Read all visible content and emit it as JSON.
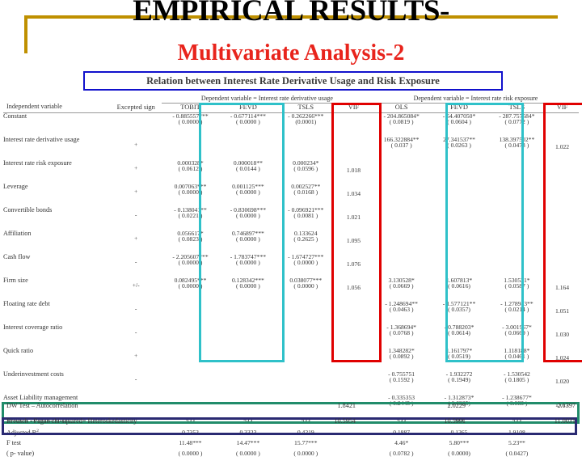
{
  "slide": {
    "title_line1": "EMPIRICAL RESULTS-",
    "title_line2": "Multivariate Analysis-2",
    "caption": "Relation between Interest Rate Derivative Usage and Risk Exposure",
    "accent_gold": "#bf9000",
    "title_red": "#e8241c",
    "caption_border": "#1111cc",
    "highlight_cyan": "#2fc1c9",
    "highlight_red": "#e00000",
    "highlight_green": "#218c6a",
    "highlight_navy": "#2a2a72"
  },
  "table": {
    "group_left": "Dependent variable = Interest rate derivative usage",
    "group_right": "Dependent variable = Interest rate risk exposure",
    "head_var": "Independent variable",
    "head_sign": "Excepted sign",
    "cols": [
      "TOBIT",
      "FEVD",
      "TSLS",
      "VIF",
      "OLS",
      "FEVD",
      "TSLS",
      "VIF"
    ],
    "rows": [
      {
        "name": "Constant",
        "sign": "",
        "tobit_c": "- 0.885557***",
        "tobit_p": "( 0.0000 )",
        "fevd_c": "- 0.677114***",
        "fevd_p": "( 0.0000 )",
        "tsls_c": "- 0.262266***",
        "tsls_p": "(0.0001)",
        "vif": "",
        "ols_c": "- 204.865084*",
        "ols_p": "( 0.0819 )",
        "fevd2_c": "- 54.407050*",
        "fevd2_p": "( 0.0604 )",
        "tsls2_c": "- 287.757584*",
        "tsls2_p": "( 0.0772 )",
        "vif2": ""
      },
      {
        "name": "Interest rate derivative usage",
        "sign": "+",
        "tobit_c": "",
        "tobit_p": "",
        "fevd_c": "",
        "fevd_p": "",
        "tsls_c": "",
        "tsls_p": "",
        "vif": "",
        "ols_c": "166.322884**",
        "ols_p": "( 0.037 )",
        "fevd2_c": "27.341537**",
        "fevd2_p": "( 0.0263 )",
        "tsls2_c": "138.397502**",
        "tsls2_p": "( 0.0473 )",
        "vif2": "1.022"
      },
      {
        "name": "Interest rate risk exposure",
        "sign": "+",
        "tobit_c": "0.000328*",
        "tobit_p": "( 0.0612 )",
        "fevd_c": "0.000018**",
        "fevd_p": "( 0.0144 )",
        "tsls_c": "0.000234*",
        "tsls_p": "( 0.0596 )",
        "vif": "1.018",
        "ols_c": "",
        "ols_p": "",
        "fevd2_c": "",
        "fevd2_p": "",
        "tsls2_c": "",
        "tsls2_p": "",
        "vif2": ""
      },
      {
        "name": "Leverage",
        "sign": "+",
        "tobit_c": "0.007063***",
        "tobit_p": "( 0.0000 )",
        "fevd_c": "0.001125***",
        "fevd_p": "( 0.0000 )",
        "tsls_c": "0.002527**",
        "tsls_p": "( 0.0168 )",
        "vif": "1.034",
        "ols_c": "",
        "ols_p": "",
        "fevd2_c": "",
        "fevd2_p": "",
        "tsls2_c": "",
        "tsls2_p": "",
        "vif2": ""
      },
      {
        "name": "Convertible bonds",
        "sign": "-",
        "tobit_c": "- 0.138041**",
        "tobit_p": "( 0.0221 )",
        "fevd_c": "- 0.830698***",
        "fevd_p": "( 0.0000 )",
        "tsls_c": "- 0.096921***",
        "tsls_p": "( 0.0081 )",
        "vif": "1.021",
        "ols_c": "",
        "ols_p": "",
        "fevd2_c": "",
        "fevd2_p": "",
        "tsls2_c": "",
        "tsls2_p": "",
        "vif2": ""
      },
      {
        "name": "Affiliation",
        "sign": "+",
        "tobit_c": "0.056617*",
        "tobit_p": "( 0.0823 )",
        "fevd_c": "0.746897***",
        "fevd_p": "( 0.0000 )",
        "tsls_c": "0.133624",
        "tsls_p": "( 0.2625 )",
        "vif": "1.095",
        "ols_c": "",
        "ols_p": "",
        "fevd2_c": "",
        "fevd2_p": "",
        "tsls2_c": "",
        "tsls2_p": "",
        "vif2": ""
      },
      {
        "name": "Cash flow",
        "sign": "-",
        "tobit_c": "- 2.205607***",
        "tobit_p": "( 0.0000 )",
        "fevd_c": "- 1.783747***",
        "fevd_p": "( 0.0000 )",
        "tsls_c": "- 1.674727***",
        "tsls_p": "( 0.0000 )",
        "vif": "1.076",
        "ols_c": "",
        "ols_p": "",
        "fevd2_c": "",
        "fevd2_p": "",
        "tsls2_c": "",
        "tsls2_p": "",
        "vif2": ""
      },
      {
        "name": "Firm size",
        "sign": "+/-",
        "tobit_c": "0.082495***",
        "tobit_p": "( 0.0000 )",
        "fevd_c": "0.128342***",
        "fevd_p": "( 0.0000 )",
        "tsls_c": "0.038077***",
        "tsls_p": "( 0.0000 )",
        "vif": "1.056",
        "ols_c": "3.130528*",
        "ols_p": "( 0.0669 )",
        "fevd2_c": "1.607813*",
        "fevd2_p": "( 0.0616)",
        "tsls2_c": "1.530521*",
        "tsls2_p": "( 0.0587 )",
        "vif2": "1.164"
      },
      {
        "name": "Floating rate debt",
        "sign": "-",
        "tobit_c": "",
        "tobit_p": "",
        "fevd_c": "",
        "fevd_p": "",
        "tsls_c": "",
        "tsls_p": "",
        "vif": "",
        "ols_c": "- 1.248694**",
        "ols_p": "( 0.0463 )",
        "fevd2_c": "- 1.577121**",
        "fevd2_p": "( 0.0357)",
        "tsls2_c": "- 1.278983**",
        "tsls2_p": "( 0.0214 )",
        "vif2": "1.051"
      },
      {
        "name": "Interest coverage ratio",
        "sign": "-",
        "tobit_c": "",
        "tobit_p": "",
        "fevd_c": "",
        "fevd_p": "",
        "tsls_c": "",
        "tsls_p": "",
        "vif": "",
        "ols_c": "- 1.368694*",
        "ols_p": "( 0.0768 )",
        "fevd2_c": "- 0.788203*",
        "fevd2_p": "( 0.0614)",
        "tsls2_c": "- 3.001967*",
        "tsls2_p": "( 0.0669 )",
        "vif2": "1.030"
      },
      {
        "name": "Quick ratio",
        "sign": "+",
        "tobit_c": "",
        "tobit_p": "",
        "fevd_c": "",
        "fevd_p": "",
        "tsls_c": "",
        "tsls_p": "",
        "vif": "",
        "ols_c": "1.348282*",
        "ols_p": "( 0.0892 )",
        "fevd2_c": "1.161797*",
        "fevd2_p": "( 0.0519)",
        "tsls2_c": "1.118188*",
        "tsls2_p": "( 0.0461 )",
        "vif2": "1.024"
      },
      {
        "name": "Underinvestment costs",
        "sign": "-",
        "tobit_c": "",
        "tobit_p": "",
        "fevd_c": "",
        "fevd_p": "",
        "tsls_c": "",
        "tsls_p": "",
        "vif": "",
        "ols_c": "- 0.755751",
        "ols_p": "( 0.1592 )",
        "fevd2_c": "- 1.932272",
        "fevd2_p": "( 0.1949)",
        "tsls2_c": "- 1.530542",
        "tsls2_p": "( 0.1805 )",
        "vif2": "1.020"
      },
      {
        "name": "Asset Liability management",
        "sign": "-",
        "tobit_c": "",
        "tobit_p": "",
        "fevd_c": "",
        "fevd_p": "",
        "tsls_c": "",
        "tsls_p": "",
        "vif": "",
        "ols_c": "- 0.335353",
        "ols_p": "( 0.2445 )",
        "fevd2_c": "- 1.312873*",
        "fevd2_p": "( 0.0965)",
        "tsls2_c": "- 1.238677*",
        "tsls2_p": "( 0.083 )",
        "vif2": "1.017"
      }
    ],
    "stats": [
      {
        "label": "Number of observations",
        "tobit": "244",
        "fevd": "244",
        "tsls": "244",
        "vif": "",
        "ols": "244",
        "fevd2": "244",
        "tsls2": "244",
        "vif2": ""
      },
      {
        "label": "Adjusted R",
        "label_sup": "2",
        "tobit": "0.7353",
        "fevd": "0.3323",
        "tsls": "0.4219",
        "vif": "",
        "ols": "0.1887",
        "fevd2": "0.1365",
        "tsls2": "1.9108",
        "vif2": ""
      },
      {
        "label": "F test",
        "tobit": "11.48***",
        "fevd": "14.47***",
        "tsls": "15.77***",
        "vif": "",
        "ols": "4.46*",
        "fevd2": "5.80***",
        "tsls2": "5.23**",
        "vif2": ""
      },
      {
        "label": "( p- value)",
        "tobit": "( 0.0000 )",
        "fevd": "( 0.0000 )",
        "tsls": "( 0.0000 )",
        "vif": "",
        "ols": "( 0.0782 )",
        "fevd2": "( 0.0000)",
        "tsls2": "( 0.0427)",
        "vif2": ""
      }
    ],
    "diagnostics": [
      {
        "label": "DW Test – Autocorrelation",
        "v1": "1.8421",
        "v2": "2.0229",
        "v3": "2.1397"
      },
      {
        "label": "Breusch - Pagan chi-squared= Heteroskedasticity",
        "v1": "10.5954",
        "v2": "10.5991",
        "v3": "11.0031"
      }
    ]
  }
}
